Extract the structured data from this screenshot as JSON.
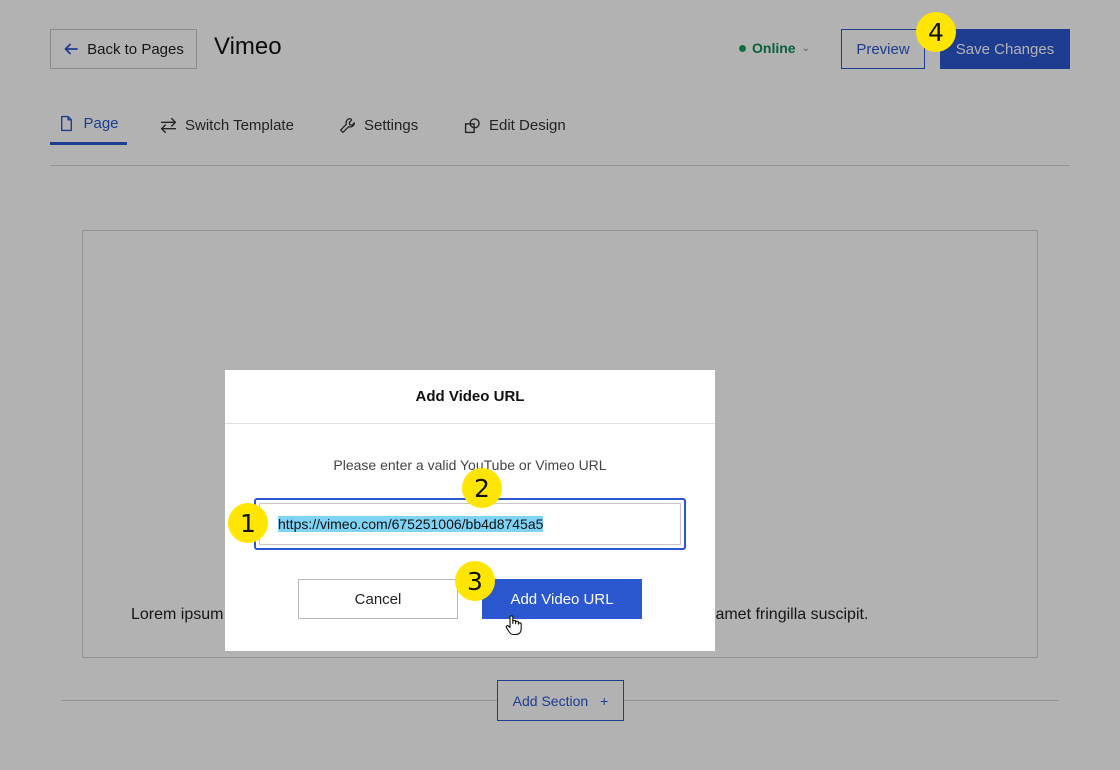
{
  "header": {
    "back_label": "Back to Pages",
    "page_title": "Vimeo",
    "status_label": "Online",
    "preview_label": "Preview",
    "save_label": "Save Changes"
  },
  "tabs": [
    {
      "label": "Page",
      "icon": "page-icon",
      "active": true
    },
    {
      "label": "Switch Template",
      "icon": "swap-arrows-icon",
      "active": false
    },
    {
      "label": "Settings",
      "icon": "wrench-icon",
      "active": false
    },
    {
      "label": "Edit Design",
      "icon": "design-icon",
      "active": false
    }
  ],
  "content": {
    "lorem_left": "Lorem ipsum",
    "lorem_right": "sit amet fringilla suscipit.",
    "add_section_label": "Add Section"
  },
  "modal": {
    "title": "Add Video URL",
    "instruction": "Please enter a valid YouTube or Vimeo URL",
    "url_value": "https://vimeo.com/675251006/bb4d8745a5",
    "cancel_label": "Cancel",
    "submit_label": "Add Video URL"
  },
  "markers": [
    "1",
    "2",
    "3",
    "4"
  ],
  "colors": {
    "accent": "#2b58d0",
    "online": "#0d8a55",
    "marker": "#ffe500",
    "selection": "#7fd3f5"
  }
}
